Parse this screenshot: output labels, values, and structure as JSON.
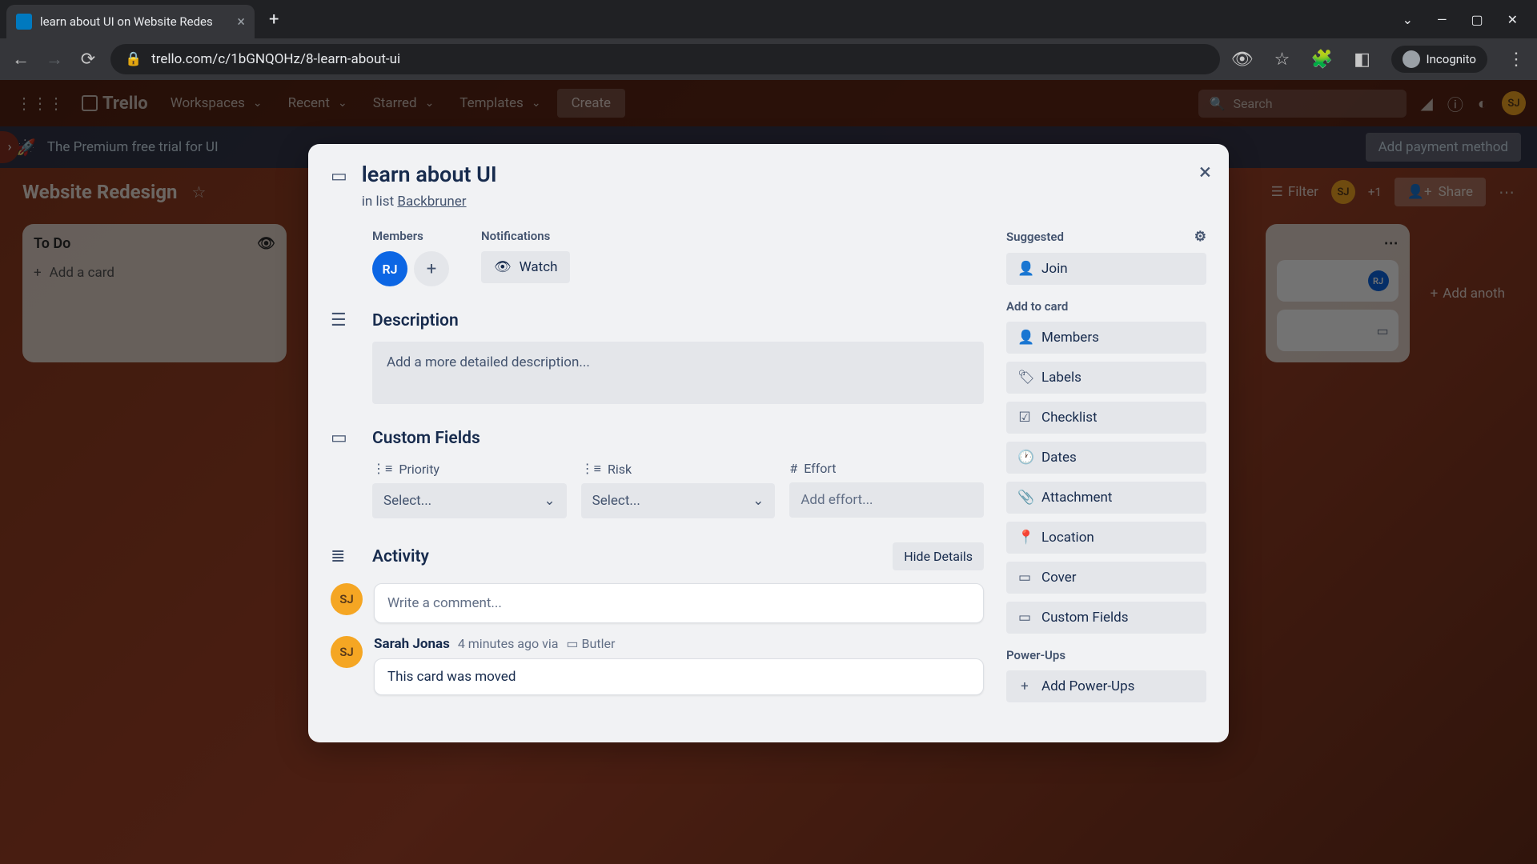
{
  "browser": {
    "tab_title": "learn about UI on Website Redes",
    "url": "trello.com/c/1bGNQOHz/8-learn-about-ui",
    "incognito_label": "Incognito"
  },
  "trello_header": {
    "logo": "Trello",
    "nav": [
      "Workspaces",
      "Recent",
      "Starred",
      "Templates"
    ],
    "create": "Create",
    "search_placeholder": "Search"
  },
  "banner": {
    "text": "The Premium free trial for UI",
    "add_payment": "Add payment method"
  },
  "board": {
    "title": "Website Redesign",
    "filter": "Filter",
    "plus_one": "+1",
    "share": "Share",
    "list_todo": "To Do",
    "add_card": "Add a card",
    "add_another": "Add anoth",
    "mini_member": "RJ"
  },
  "card": {
    "title": "learn about UI",
    "in_list_prefix": "in list ",
    "list_name": "Backbruner",
    "members_label": "Members",
    "member_initials": "RJ",
    "notifications_label": "Notifications",
    "watch": "Watch",
    "description_title": "Description",
    "description_placeholder": "Add a more detailed description...",
    "custom_fields_title": "Custom Fields",
    "cf": {
      "priority_label": "Priority",
      "priority_value": "Select...",
      "risk_label": "Risk",
      "risk_value": "Select...",
      "effort_label": "Effort",
      "effort_placeholder": "Add effort..."
    },
    "activity_title": "Activity",
    "hide_details": "Hide Details",
    "comment_placeholder": "Write a comment...",
    "commenter_initials": "SJ",
    "activity_entry": {
      "author": "Sarah Jonas",
      "time": "4 minutes ago via",
      "via": "Butler",
      "body": "This card was moved"
    }
  },
  "sidebar": {
    "suggested": "Suggested",
    "join": "Join",
    "add_to_card": "Add to card",
    "members": "Members",
    "labels": "Labels",
    "checklist": "Checklist",
    "dates": "Dates",
    "attachment": "Attachment",
    "location": "Location",
    "cover": "Cover",
    "custom_fields": "Custom Fields",
    "powerups": "Power-Ups",
    "add_powerups": "Add Power-Ups"
  }
}
